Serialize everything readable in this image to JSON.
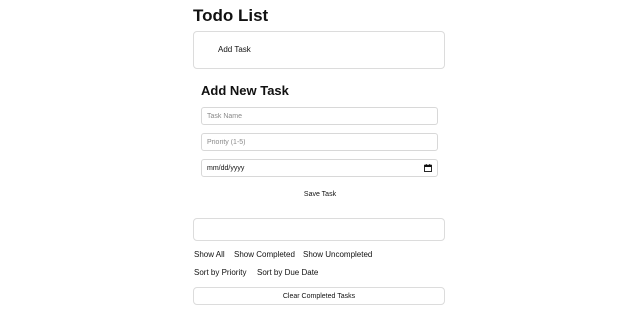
{
  "app": {
    "title": "Todo List"
  },
  "add_section": {
    "add_task_label": "Add Task"
  },
  "form": {
    "heading": "Add New Task",
    "task_name": {
      "value": "",
      "placeholder": "Task Name"
    },
    "priority": {
      "value": "",
      "placeholder": "Priority (1-5)"
    },
    "due_date": {
      "display": "mm/dd/yyyy",
      "icon": "calendar-icon"
    },
    "save_label": "Save Task"
  },
  "task_list": {
    "items": []
  },
  "filters": {
    "show_all": "Show All",
    "show_completed": "Show Completed",
    "show_uncompleted": "Show Uncompleted"
  },
  "sorting": {
    "by_priority": "Sort by Priority",
    "by_due_date": "Sort by Due Date"
  },
  "actions": {
    "clear_completed": "Clear Completed Tasks"
  },
  "colors": {
    "border": "#dcdcdc",
    "text": "#111111",
    "placeholder": "#8a8a8a",
    "background": "#ffffff"
  }
}
